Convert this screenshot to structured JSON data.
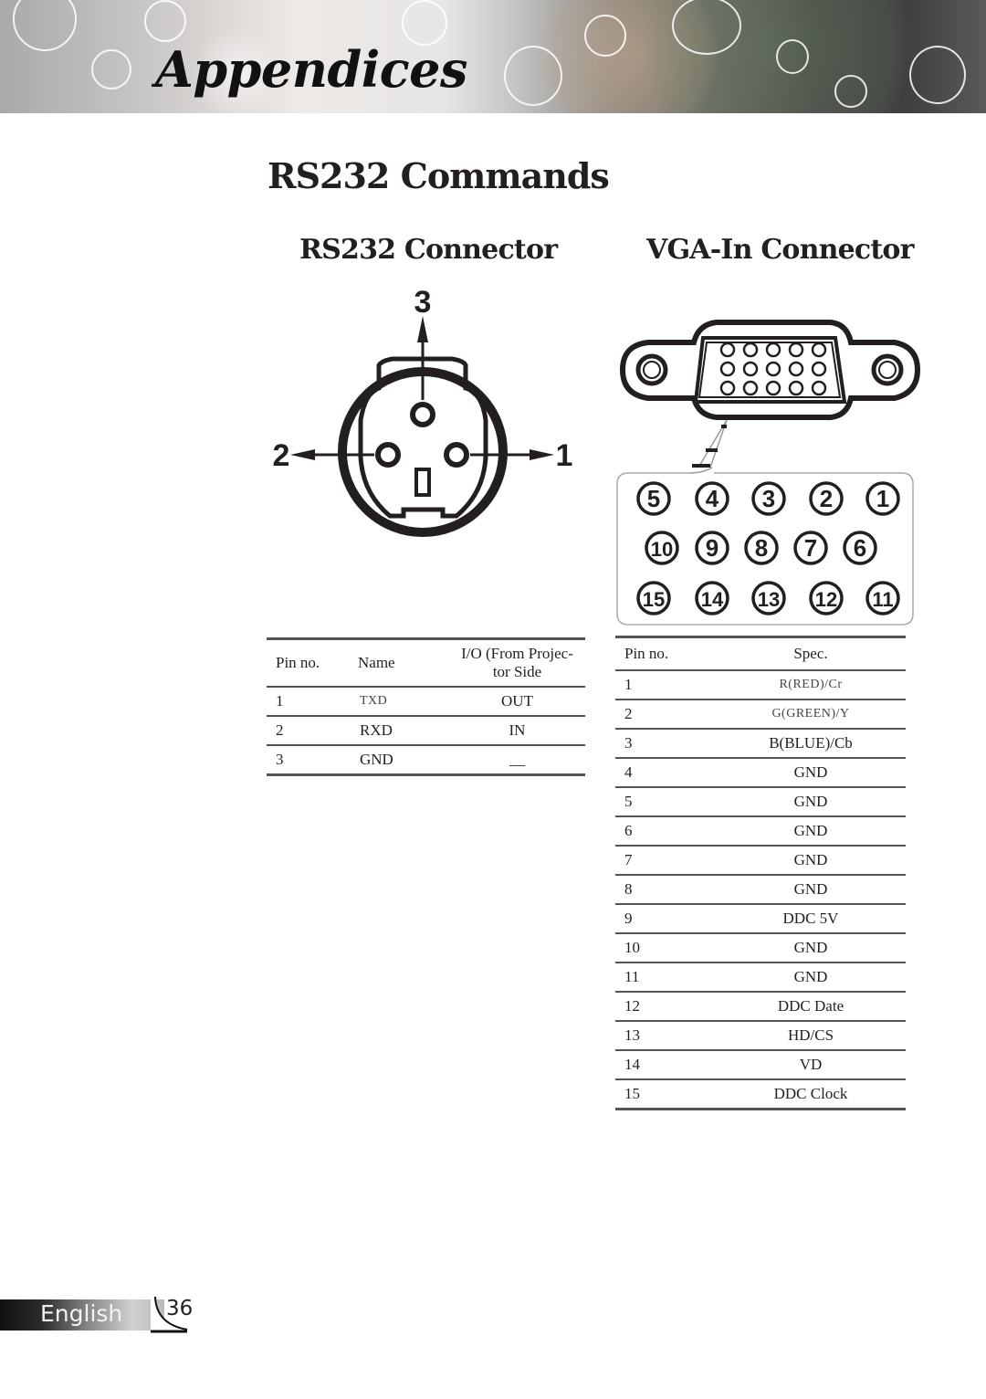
{
  "header": {
    "title": "Appendices"
  },
  "page": {
    "title": "RS232 Commands",
    "rs232_section_title": "RS232 Connector",
    "vga_section_title": "VGA-In Connector"
  },
  "rs232_diagram": {
    "pin_labels": [
      "1",
      "2",
      "3"
    ]
  },
  "vga_diagram": {
    "rows": [
      [
        "5",
        "4",
        "3",
        "2",
        "1"
      ],
      [
        "10",
        "9",
        "8",
        "7",
        "6"
      ],
      [
        "15",
        "14",
        "13",
        "12",
        "11"
      ]
    ]
  },
  "rs232_table": {
    "headers": {
      "pin": "Pin no.",
      "name": "Name",
      "io_line1": "I/O (From Projec-",
      "io_line2": "tor Side"
    },
    "rows": [
      {
        "pin": "1",
        "name": "TXD",
        "io": "OUT"
      },
      {
        "pin": "2",
        "name": "RXD",
        "io": "IN"
      },
      {
        "pin": "3",
        "name": "GND",
        "io": "__"
      }
    ]
  },
  "vga_table": {
    "headers": {
      "pin": "Pin no.",
      "spec": "Spec."
    },
    "rows": [
      {
        "pin": "1",
        "spec": "R(RED)/Cr"
      },
      {
        "pin": "2",
        "spec": "G(GREEN)/Y"
      },
      {
        "pin": "3",
        "spec": "B(BLUE)/Cb"
      },
      {
        "pin": "4",
        "spec": "GND"
      },
      {
        "pin": "5",
        "spec": "GND"
      },
      {
        "pin": "6",
        "spec": "GND"
      },
      {
        "pin": "7",
        "spec": "GND"
      },
      {
        "pin": "8",
        "spec": "GND"
      },
      {
        "pin": "9",
        "spec": "DDC 5V"
      },
      {
        "pin": "10",
        "spec": "GND"
      },
      {
        "pin": "11",
        "spec": "GND"
      },
      {
        "pin": "12",
        "spec": "DDC Date"
      },
      {
        "pin": "13",
        "spec": "HD/CS"
      },
      {
        "pin": "14",
        "spec": "VD"
      },
      {
        "pin": "15",
        "spec": "DDC Clock"
      }
    ]
  },
  "footer": {
    "language": "English",
    "page_number": "36"
  }
}
